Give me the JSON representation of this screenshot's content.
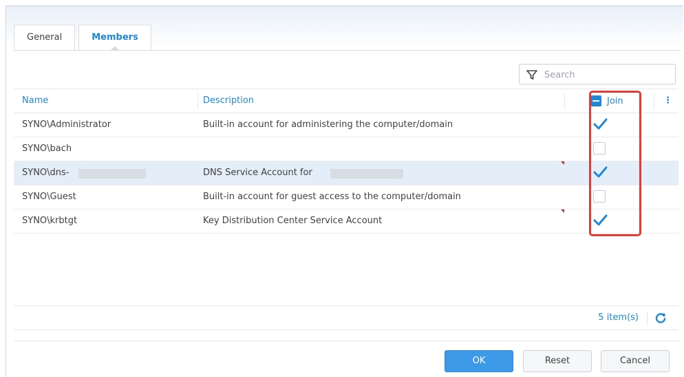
{
  "tabs": [
    {
      "label": "General",
      "active": false
    },
    {
      "label": "Members",
      "active": true
    }
  ],
  "search": {
    "placeholder": "Search",
    "icon": "filter-icon"
  },
  "columns": {
    "name": "Name",
    "description": "Description",
    "join": "Join"
  },
  "rows": [
    {
      "name": "SYNO\\Administrator",
      "description": "Built-in account for administering the computer/domain",
      "join": true,
      "selected": false
    },
    {
      "name": "SYNO\\bach",
      "description": "",
      "join": false,
      "selected": false
    },
    {
      "name": "SYNO\\dns-",
      "description": "DNS Service Account for",
      "join": true,
      "selected": true,
      "redacted": true
    },
    {
      "name": "SYNO\\Guest",
      "description": "Built-in account for guest access to the computer/domain",
      "join": false,
      "selected": false
    },
    {
      "name": "SYNO\\krbtgt",
      "description": "Key Distribution Center Service Account",
      "join": true,
      "selected": false
    }
  ],
  "footer": {
    "count": "5 item(s)"
  },
  "buttons": {
    "ok": "OK",
    "reset": "Reset",
    "cancel": "Cancel"
  },
  "colors": {
    "accent": "#1e88d6",
    "highlight": "#e53935",
    "primary_button": "#3d9ae8"
  }
}
